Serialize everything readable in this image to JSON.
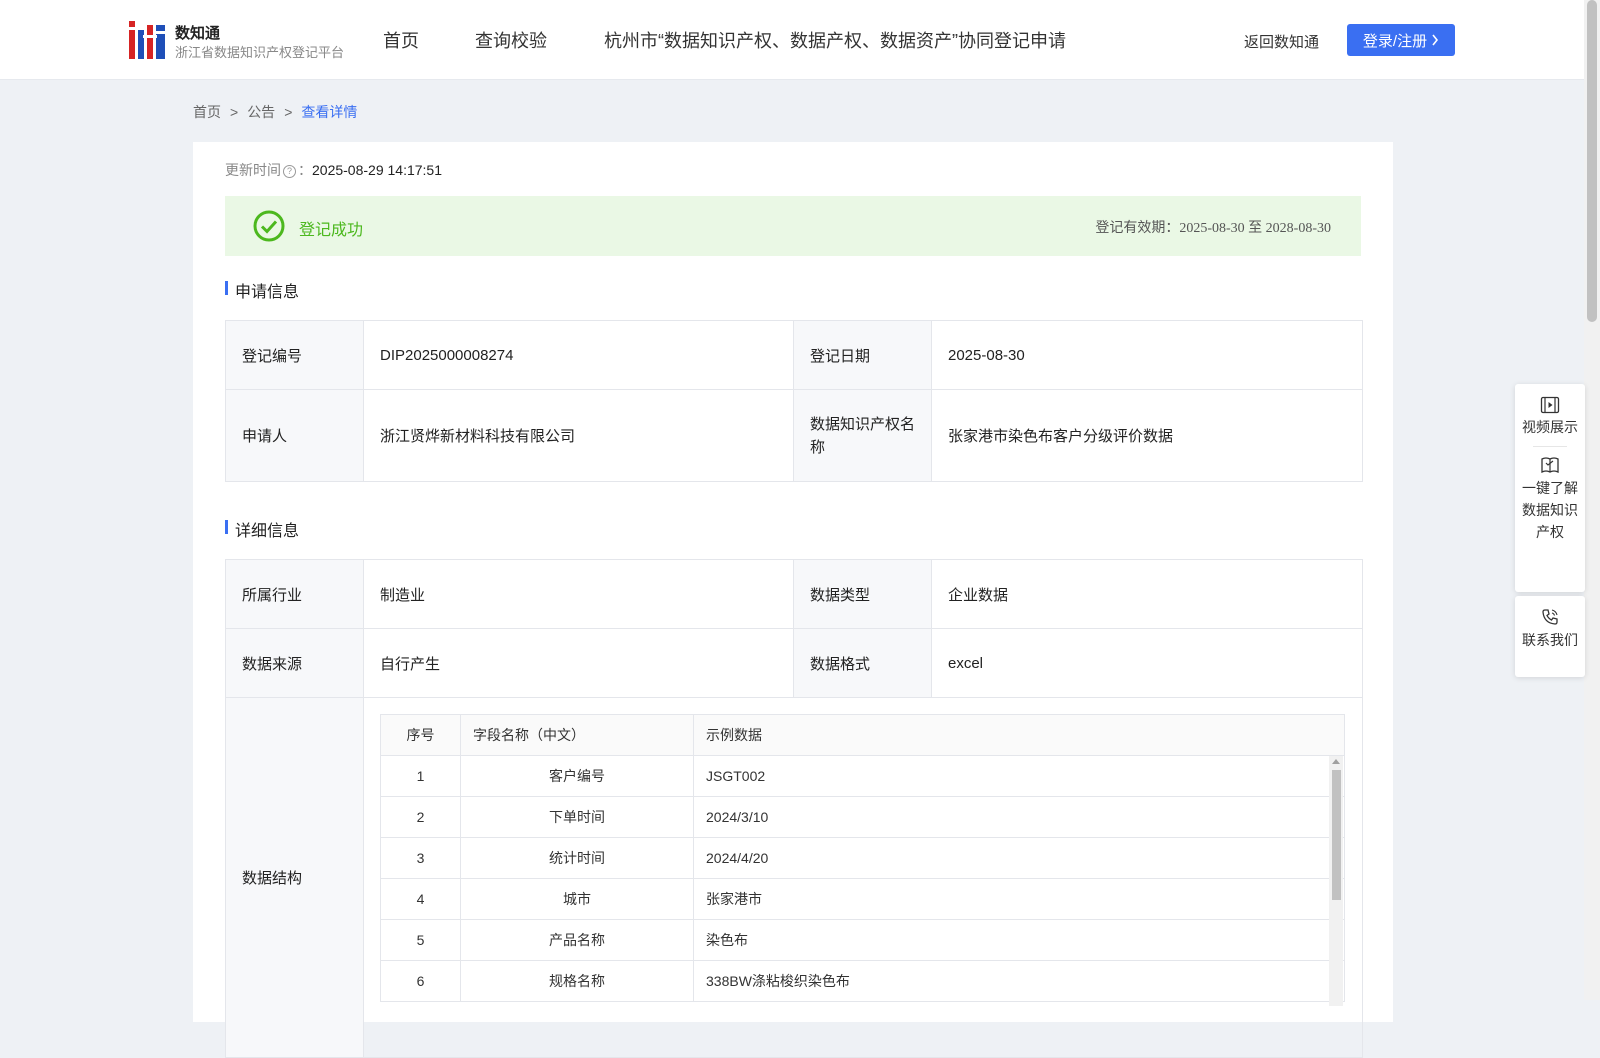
{
  "header": {
    "brand_title": "数知通",
    "brand_subtitle": "浙江省数据知识产权登记平台",
    "nav": [
      "首页",
      "查询校验",
      "杭州市“数据知识产权、数据产权、数据资产”协同登记申请"
    ],
    "back_link": "返回数知通",
    "login_label": "登录/注册",
    "accent_color": "#3a6ff2"
  },
  "breadcrumb": {
    "items": [
      "首页",
      "公告"
    ],
    "separator": ">",
    "current": "查看详情"
  },
  "update": {
    "label": "更新时间",
    "colon": "：",
    "value": "2025-08-29 14:17:51"
  },
  "status": {
    "text": "登记成功",
    "validity_label": "登记有效期：",
    "validity_start": "2025-08-30",
    "validity_to": "至",
    "validity_end": "2028-08-30",
    "color": "#4cb81e"
  },
  "application": {
    "title": "申请信息",
    "reg_no_label": "登记编号",
    "reg_no": "DIP2025000008274",
    "reg_date_label": "登记日期",
    "reg_date": "2025-08-30",
    "applicant_label": "申请人",
    "applicant": "浙江贤烨新材料科技有限公司",
    "ip_name_label": "数据知识产权名称",
    "ip_name": "张家港市染色布客户分级评价数据"
  },
  "detail": {
    "title": "详细信息",
    "industry_label": "所属行业",
    "industry": "制造业",
    "type_label": "数据类型",
    "type": "企业数据",
    "source_label": "数据来源",
    "source": "自行产生",
    "format_label": "数据格式",
    "format": "excel",
    "structure_label": "数据结构",
    "structure_columns": [
      "序号",
      "字段名称（中文）",
      "示例数据"
    ],
    "structure_rows": [
      [
        "1",
        "客户编号",
        "JSGT002"
      ],
      [
        "2",
        "下单时间",
        "2024/3/10"
      ],
      [
        "3",
        "统计时间",
        "2024/4/20"
      ],
      [
        "4",
        "城市",
        "张家港市"
      ],
      [
        "5",
        "产品名称",
        "染色布"
      ],
      [
        "6",
        "规格名称",
        "338BW涤粘梭织染色布"
      ]
    ]
  },
  "float_panel": {
    "video": "视频展示",
    "learn": [
      "一键了解",
      "数据知识",
      "产权"
    ],
    "contact": "联系我们"
  }
}
